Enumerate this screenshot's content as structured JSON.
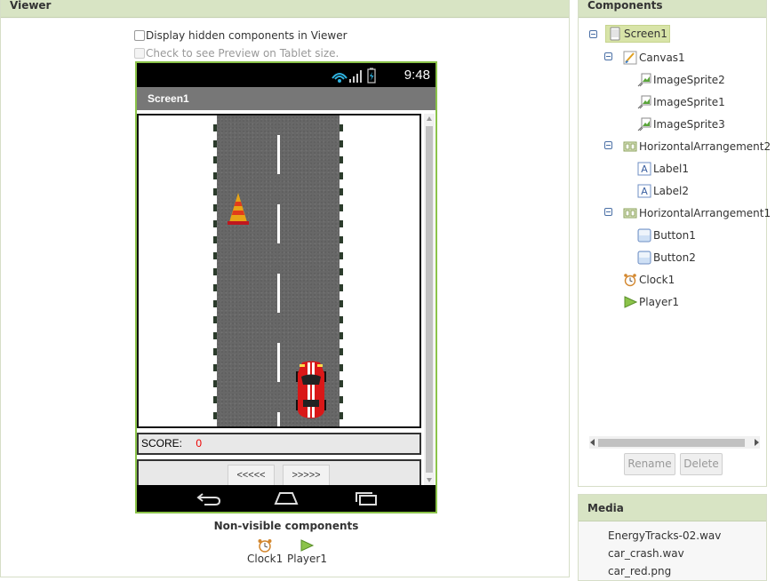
{
  "viewer": {
    "title": "Viewer",
    "display_hidden_label": "Display hidden components in Viewer",
    "tablet_preview_label": "Check to see Preview on Tablet size.",
    "phone": {
      "status_time": "9:48",
      "screen_title": "Screen1",
      "score_label": "SCORE:",
      "score_value": "0",
      "left_button": "<<<<<",
      "right_button": ">>>>>"
    },
    "non_visible_title": "Non-visible components",
    "non_visible_items": [
      "Clock1",
      "Player1"
    ]
  },
  "components": {
    "title": "Components",
    "tree": [
      {
        "label": "Screen1",
        "icon": "screen-icon",
        "selected": true
      },
      {
        "label": "Canvas1",
        "icon": "canvas-icon"
      },
      {
        "label": "ImageSprite2",
        "icon": "image-sprite-icon"
      },
      {
        "label": "ImageSprite1",
        "icon": "image-sprite-icon"
      },
      {
        "label": "ImageSprite3",
        "icon": "image-sprite-icon"
      },
      {
        "label": "HorizontalArrangement2",
        "icon": "horizontal-arrangement-icon"
      },
      {
        "label": "Label1",
        "icon": "label-icon"
      },
      {
        "label": "Label2",
        "icon": "label-icon"
      },
      {
        "label": "HorizontalArrangement1",
        "icon": "horizontal-arrangement-icon"
      },
      {
        "label": "Button1",
        "icon": "button-icon"
      },
      {
        "label": "Button2",
        "icon": "button-icon"
      },
      {
        "label": "Clock1",
        "icon": "clock-icon"
      },
      {
        "label": "Player1",
        "icon": "player-icon"
      }
    ],
    "rename_button": "Rename",
    "delete_button": "Delete"
  },
  "media": {
    "title": "Media",
    "files": [
      "EnergyTracks-02.wav",
      "car_crash.wav",
      "car_red.png"
    ]
  },
  "colors": {
    "header_bg": "#d8e4c4",
    "phone_border": "#8bc34a",
    "score_value": "#e00000"
  }
}
